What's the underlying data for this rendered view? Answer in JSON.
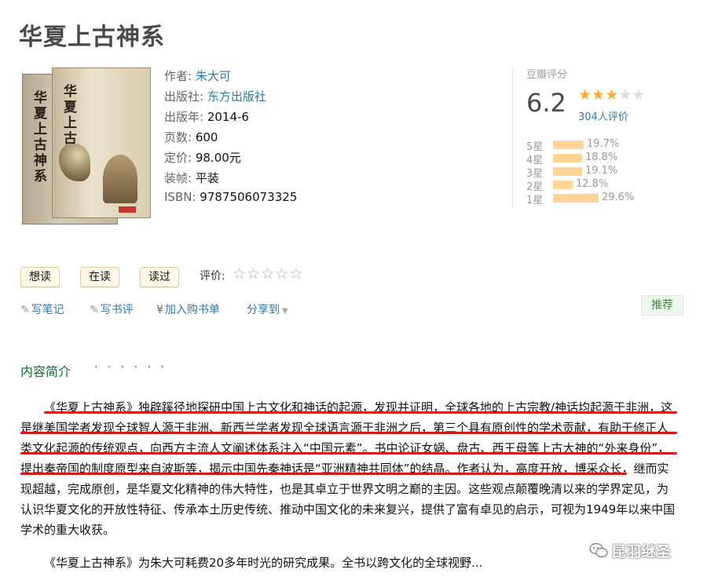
{
  "page": {
    "title": "华夏上古神系"
  },
  "cover": {
    "title_text": "华夏上古神系"
  },
  "meta": {
    "author_label": "作者:",
    "author": "朱大可",
    "publisher_label": "出版社:",
    "publisher": "东方出版社",
    "year_label": "出版年:",
    "year": "2014-6",
    "pages_label": "页数:",
    "pages": "600",
    "price_label": "定价:",
    "price": "98.00元",
    "binding_label": "装帧:",
    "binding": "平装",
    "isbn_label": "ISBN:",
    "isbn": "9787506073325"
  },
  "rating": {
    "label": "豆瓣评分",
    "score": "6.2",
    "stars_value": 3,
    "stars_max": 5,
    "count_text": "304人评价",
    "breakdown": [
      {
        "label": "5星",
        "pct": "19.7%",
        "value": 19.7
      },
      {
        "label": "4星",
        "pct": "18.8%",
        "value": 18.8
      },
      {
        "label": "3星",
        "pct": "19.1%",
        "value": 19.1
      },
      {
        "label": "2星",
        "pct": "12.8%",
        "value": 12.8
      },
      {
        "label": "1星",
        "pct": "29.6%",
        "value": 29.6
      }
    ]
  },
  "actions": {
    "want": "想读",
    "reading": "在读",
    "read": "读过",
    "rate_label": "评价:",
    "rate_stars": "☆☆☆☆☆",
    "write_note": "写笔记",
    "write_review": "写书评",
    "add_cart": "加入购书单",
    "share": "分享到",
    "recommend": "推荐"
  },
  "intro": {
    "title": "内容简介",
    "dots": "· · · · · ·",
    "para1": "《华夏上古神系》独辟蹊径地探研中国上古文化和神话的起源，发现并证明，全球各地的上古宗教/神话均起源于非洲，这是继美国学者发现全球智人源于非洲、新西兰学者发现全球语言源于非洲之后，第三个具有原创性的学术贡献，有助于修正人类文化起源的传统观点，向西方主流人文阐述体系注入“中国元素”。书中论证女娲、盘古、西王母等上古大神的“外来身份”，提出秦帝国的制度原型来自波斯等，揭示中国先秦神话是“亚洲精神共同体”的结晶。作者认为，高度开放，博采众长，继而实现超越，完成原创，是华夏文化精神的伟大特性，也是其卓立于世界文明之巅的主因。这些观点颠覆晚清以来的学界定见，为认识华夏文化的开放性特征、传承本土历史传统、推动中国文化的未来复兴，提供了富有卓见的启示，可视为1949年以来中国学术的重大收获。",
    "para2": "《华夏上古神系》为朱大可耗费20多年时光的研究成果。全书以跨文化的全球视野..."
  },
  "watermark": {
    "text": "昆羽继圣"
  },
  "colors": {
    "link": "#3377aa",
    "star": "#ffac2d",
    "bar": "#ffd596",
    "green": "#007722",
    "underline": "#d01a1a"
  }
}
